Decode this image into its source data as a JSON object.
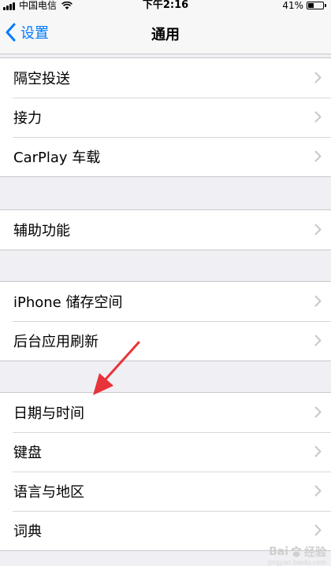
{
  "status_bar": {
    "carrier": "中国电信",
    "time": "下午2:16",
    "battery_percent": "41%",
    "battery_level": 0.41
  },
  "nav": {
    "back_label": "设置",
    "title": "通用"
  },
  "groups": [
    {
      "rows": [
        {
          "label": "隔空投送"
        },
        {
          "label": "接力"
        },
        {
          "label": "CarPlay 车载"
        }
      ]
    },
    {
      "rows": [
        {
          "label": "辅助功能"
        }
      ]
    },
    {
      "rows": [
        {
          "label": "iPhone 储存空间"
        },
        {
          "label": "后台应用刷新"
        }
      ]
    },
    {
      "rows": [
        {
          "label": "日期与时间"
        },
        {
          "label": "键盘"
        },
        {
          "label": "语言与地区"
        },
        {
          "label": "词典"
        }
      ]
    }
  ],
  "watermark": {
    "brand": "Bai",
    "suffix": "经验",
    "url": "jingyan.baidu.com"
  },
  "colors": {
    "accent": "#007aff",
    "annotation_arrow": "#e8333a",
    "background": "#efeff4"
  }
}
